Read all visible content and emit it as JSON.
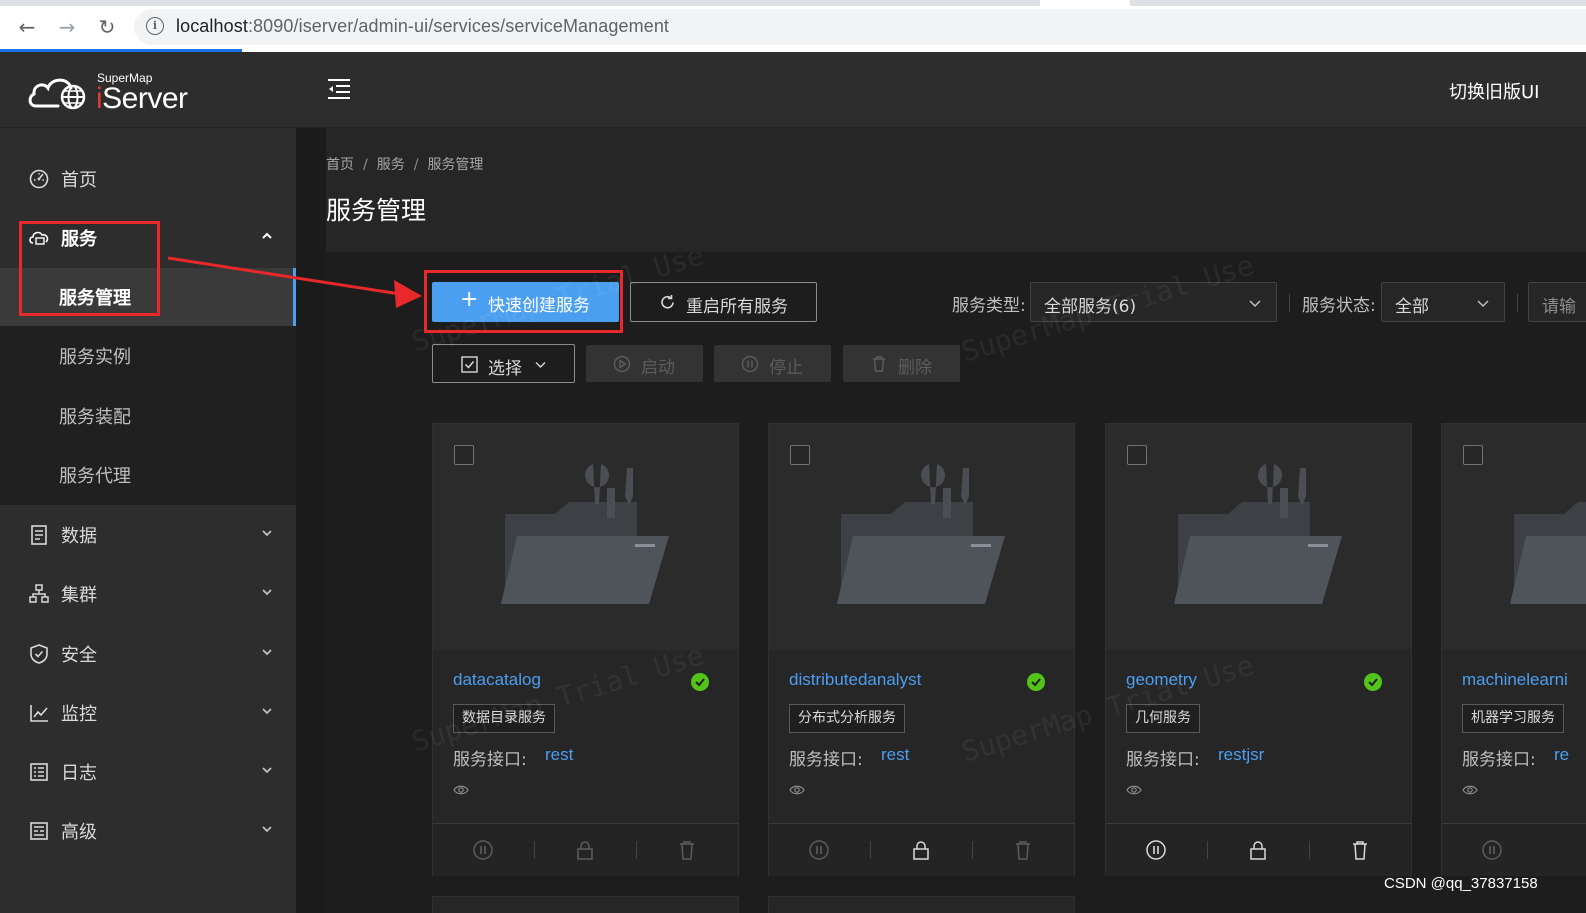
{
  "browser": {
    "url_host": "localhost",
    "url_rest": ":8090/iserver/admin-ui/services/serviceManagement",
    "back_icon": "arrow-left-icon",
    "forward_icon": "arrow-right-icon",
    "reload_icon": "reload-icon",
    "info_icon": "info-icon"
  },
  "logo": {
    "small": "SuperMap",
    "big_i": "i",
    "big_rest": "Server"
  },
  "header": {
    "old_ui": "切换旧版UI"
  },
  "sidebar": {
    "items": [
      {
        "label": "首页",
        "icon": "dashboard-icon"
      },
      {
        "label": "服务",
        "icon": "cloud-service-icon"
      },
      {
        "label": "数据",
        "icon": "data-icon"
      },
      {
        "label": "集群",
        "icon": "cluster-icon"
      },
      {
        "label": "安全",
        "icon": "shield-icon"
      },
      {
        "label": "监控",
        "icon": "line-chart-icon"
      },
      {
        "label": "日志",
        "icon": "log-icon"
      },
      {
        "label": "高级",
        "icon": "advanced-icon"
      }
    ],
    "service_submenu": [
      {
        "label": "服务管理",
        "active": true
      },
      {
        "label": "服务实例"
      },
      {
        "label": "服务装配"
      },
      {
        "label": "服务代理"
      }
    ]
  },
  "breadcrumb": [
    "首页",
    "服务",
    "服务管理"
  ],
  "page_title": "服务管理",
  "toolbar": {
    "quick_create": "快速创建服务",
    "restart_all": "重启所有服务",
    "select": "选择",
    "start": "启动",
    "stop": "停止",
    "delete": "删除"
  },
  "filters": {
    "type_label": "服务类型:",
    "type_value": "全部服务(6)",
    "status_label": "服务状态:",
    "status_value": "全部",
    "search_partial": "请输"
  },
  "cards": [
    {
      "name": "datacatalog",
      "tag": "数据目录服务",
      "iface_label": "服务接口:",
      "iface": "rest"
    },
    {
      "name": "distributedanalyst",
      "tag": "分布式分析服务",
      "iface_label": "服务接口:",
      "iface": "rest"
    },
    {
      "name": "geometry",
      "tag": "几何服务",
      "iface_label": "服务接口:",
      "iface": "restjsr"
    },
    {
      "name": "machinelearni",
      "tag": "机器学习服务",
      "iface_label": "服务接口:",
      "iface": "re"
    }
  ],
  "watermark": "SuperMap Trial Use",
  "footer_credit": "CSDN @qq_37837158",
  "colors": {
    "accent": "#4b9ff0",
    "annotation": "#e8282b",
    "status_ok": "#52c41a"
  }
}
